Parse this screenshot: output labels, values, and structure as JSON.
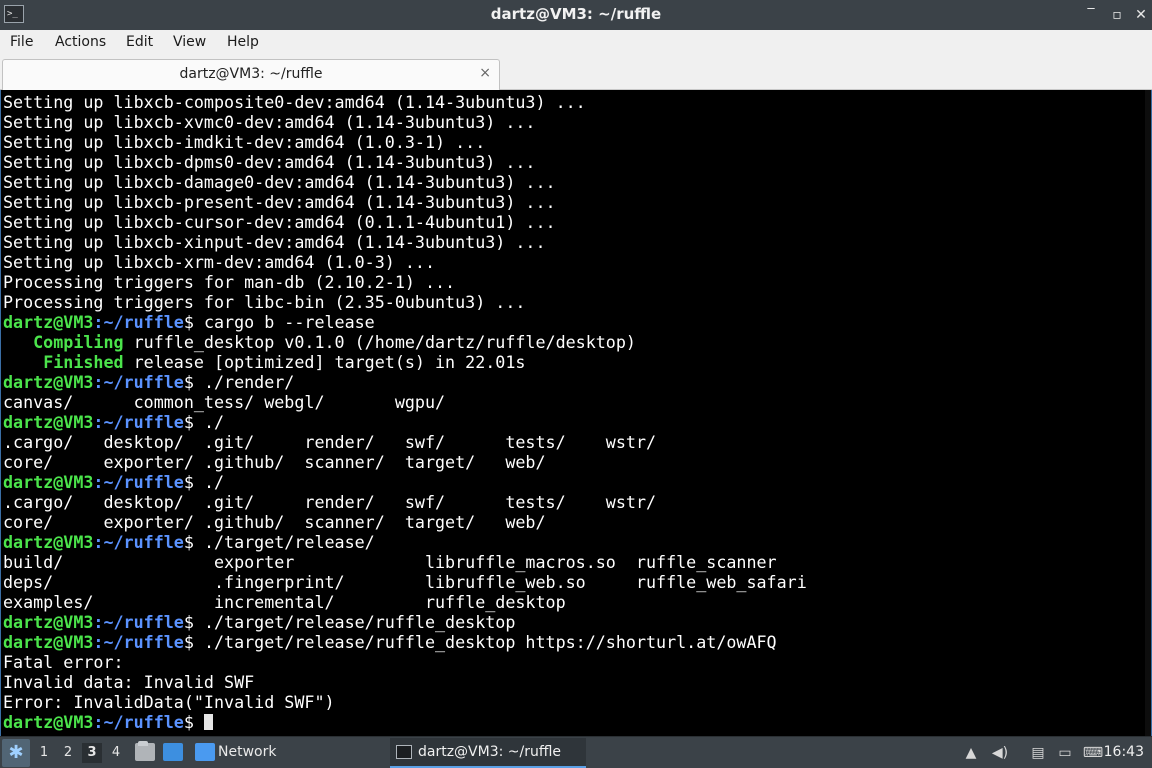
{
  "window": {
    "title": "dartz@VM3: ~/ruffle",
    "controls": {
      "minimize": "‾",
      "maximize": "▫",
      "close": "✕"
    }
  },
  "menu": [
    "File",
    "Actions",
    "Edit",
    "View",
    "Help"
  ],
  "tab": {
    "label": "dartz@VM3: ~/ruffle",
    "close": "×"
  },
  "terminal": {
    "prompt_user": "dartz@VM3",
    "prompt_path": ":~/ruffle",
    "prompt_symbol": "$ ",
    "lines": [
      {
        "t": "text",
        "text": "Setting up libxcb-composite0-dev:amd64 (1.14-3ubuntu3) ..."
      },
      {
        "t": "text",
        "text": "Setting up libxcb-xvmc0-dev:amd64 (1.14-3ubuntu3) ..."
      },
      {
        "t": "text",
        "text": "Setting up libxcb-imdkit-dev:amd64 (1.0.3-1) ..."
      },
      {
        "t": "text",
        "text": "Setting up libxcb-dpms0-dev:amd64 (1.14-3ubuntu3) ..."
      },
      {
        "t": "text",
        "text": "Setting up libxcb-damage0-dev:amd64 (1.14-3ubuntu3) ..."
      },
      {
        "t": "text",
        "text": "Setting up libxcb-present-dev:amd64 (1.14-3ubuntu3) ..."
      },
      {
        "t": "text",
        "text": "Setting up libxcb-cursor-dev:amd64 (0.1.1-4ubuntu1) ..."
      },
      {
        "t": "text",
        "text": "Setting up libxcb-xinput-dev:amd64 (1.14-3ubuntu3) ..."
      },
      {
        "t": "text",
        "text": "Setting up libxcb-xrm-dev:amd64 (1.0-3) ..."
      },
      {
        "t": "text",
        "text": "Processing triggers for man-db (2.10.2-1) ..."
      },
      {
        "t": "text",
        "text": "Processing triggers for libc-bin (2.35-0ubuntu3) ..."
      },
      {
        "t": "prompt",
        "cmd": "cargo b --release"
      },
      {
        "t": "status",
        "lead": "   ",
        "key": "Compiling",
        "rest": " ruffle_desktop v0.1.0 (/home/dartz/ruffle/desktop)"
      },
      {
        "t": "status",
        "lead": "    ",
        "key": "Finished",
        "rest": " release [optimized] target(s) in 22.01s"
      },
      {
        "t": "prompt",
        "cmd": "./render/"
      },
      {
        "t": "text",
        "text": "canvas/      common_tess/ webgl/       wgpu/"
      },
      {
        "t": "prompt",
        "cmd": "./"
      },
      {
        "t": "text",
        "text": ".cargo/   desktop/  .git/     render/   swf/      tests/    wstr/"
      },
      {
        "t": "text",
        "text": "core/     exporter/ .github/  scanner/  target/   web/"
      },
      {
        "t": "prompt",
        "cmd": "./"
      },
      {
        "t": "text",
        "text": ".cargo/   desktop/  .git/     render/   swf/      tests/    wstr/"
      },
      {
        "t": "text",
        "text": "core/     exporter/ .github/  scanner/  target/   web/"
      },
      {
        "t": "prompt",
        "cmd": "./target/release/"
      },
      {
        "t": "text",
        "text": "build/               exporter             libruffle_macros.so  ruffle_scanner"
      },
      {
        "t": "text",
        "text": "deps/                .fingerprint/        libruffle_web.so     ruffle_web_safari"
      },
      {
        "t": "text",
        "text": "examples/            incremental/         ruffle_desktop"
      },
      {
        "t": "prompt",
        "cmd": "./target/release/ruffle_desktop"
      },
      {
        "t": "prompt",
        "cmd": "./target/release/ruffle_desktop https://shorturl.at/owAFQ"
      },
      {
        "t": "text",
        "text": "Fatal error:"
      },
      {
        "t": "text",
        "text": "Invalid data: Invalid SWF"
      },
      {
        "t": "text",
        "text": "Error: InvalidData(\"Invalid SWF\")"
      },
      {
        "t": "prompt",
        "cmd": "",
        "cursor": true
      }
    ]
  },
  "taskbar": {
    "workspaces": [
      "1",
      "2",
      "3",
      "4"
    ],
    "active_workspace": "3",
    "network_label": "Network",
    "task_label": "dartz@VM3: ~/ruffle",
    "tray_icons": [
      "up-arrow-icon",
      "speaker-icon",
      "clipboard-icon",
      "display-icon",
      "keyboard-icon"
    ],
    "clock": "16:43"
  }
}
